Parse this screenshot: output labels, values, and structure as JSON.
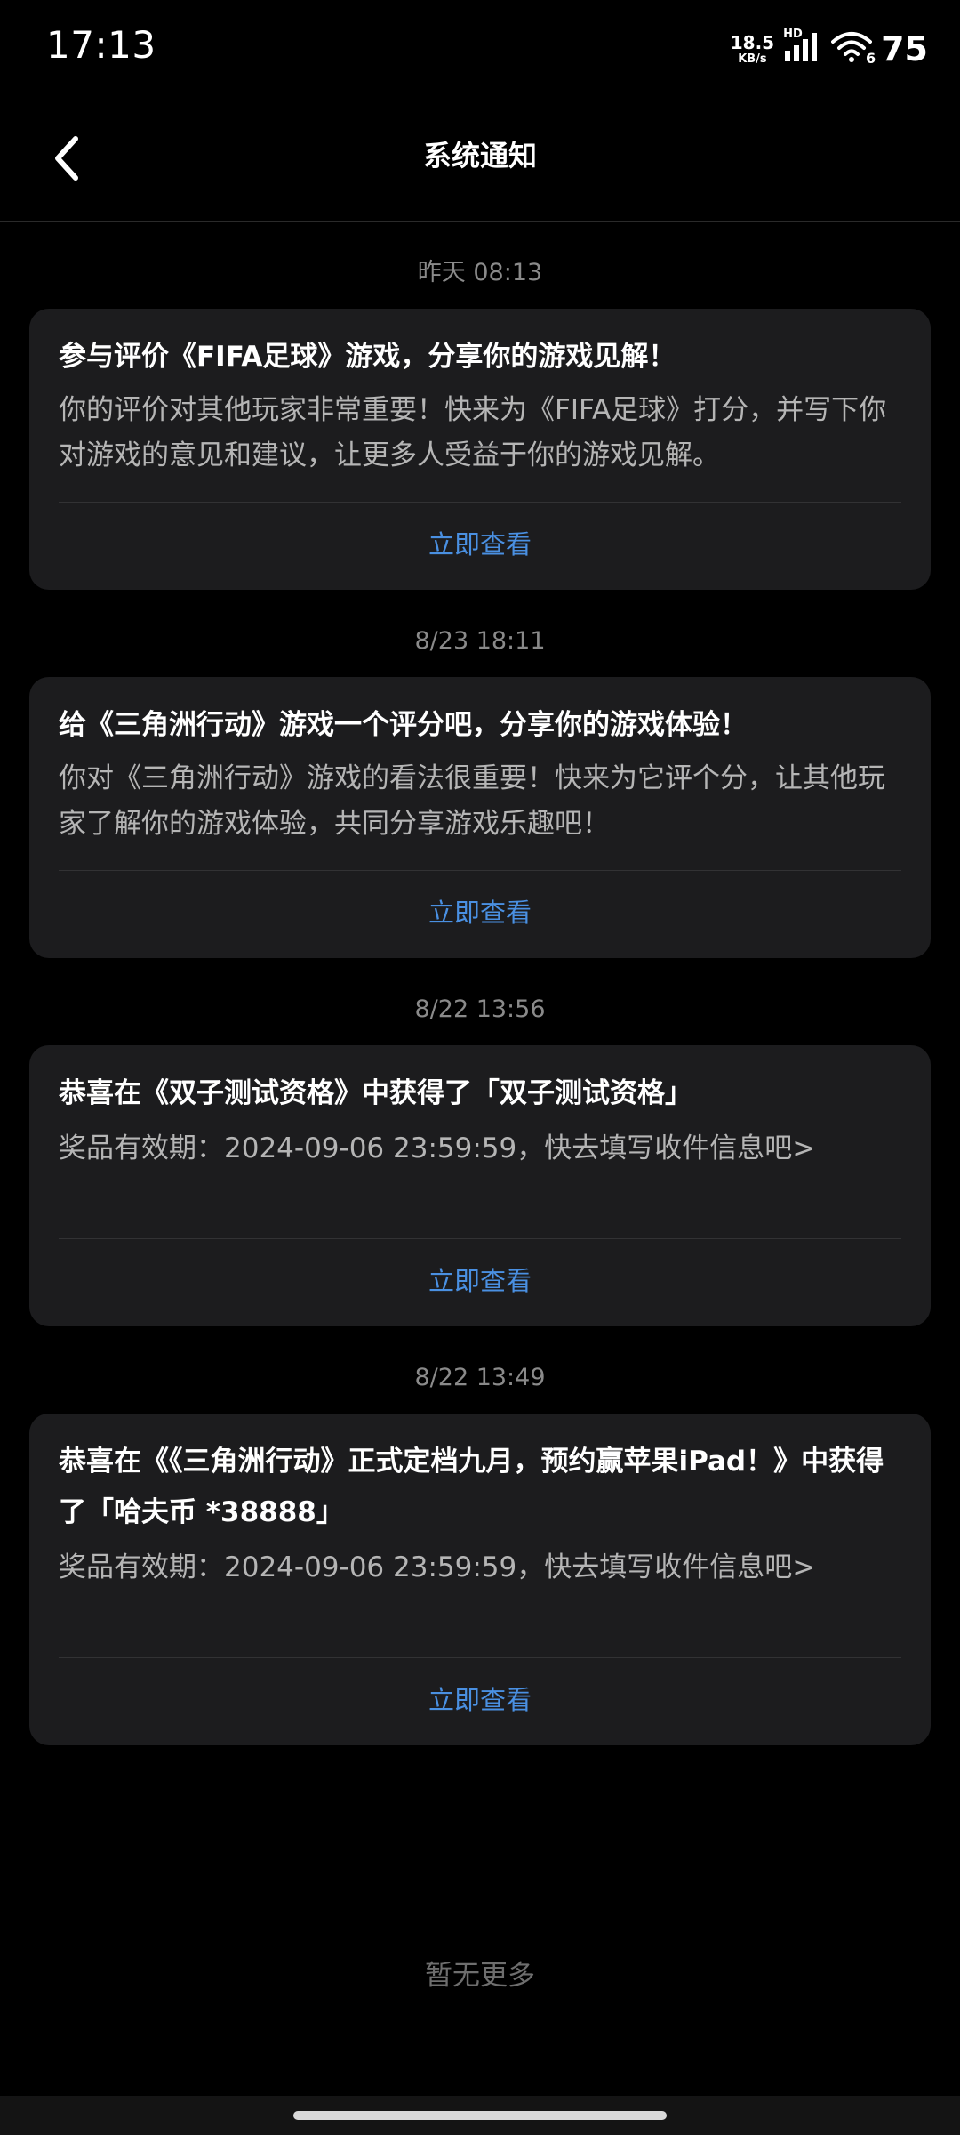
{
  "status_bar": {
    "time": "17:13",
    "net_speed_value": "18.5",
    "net_speed_unit": "KB/s",
    "hd_label": "HD",
    "wifi_badge": "6",
    "battery": "75"
  },
  "header": {
    "title": "系统通知"
  },
  "notices": [
    {
      "timestamp": "昨天  08:13",
      "title": "参与评价《FIFA足球》游戏，分享你的游戏见解！",
      "body": "你的评价对其他玩家非常重要！快来为《FIFA足球》打分，并写下你对游戏的意见和建议，让更多人受益于你的游戏见解。",
      "action": "立即查看"
    },
    {
      "timestamp": "8/23  18:11",
      "title": "给《三角洲行动》游戏一个评分吧，分享你的游戏体验！",
      "body": "你对《三角洲行动》游戏的看法很重要！快来为它评个分，让其他玩家了解你的游戏体验，共同分享游戏乐趣吧！",
      "action": "立即查看"
    },
    {
      "timestamp": "8/22  13:56",
      "title": "恭喜在《双子测试资格》中获得了「双子测试资格」",
      "body": "奖品有效期：2024-09-06 23:59:59，快去填写收件信息吧>",
      "action": "立即查看"
    },
    {
      "timestamp": "8/22  13:49",
      "title": "恭喜在《《三角洲行动》正式定档九月，预约赢苹果iPad！》中获得了「哈夫币 *38888」",
      "body": "奖品有效期：2024-09-06 23:59:59，快去填写收件信息吧>",
      "action": "立即查看"
    }
  ],
  "footer": {
    "no_more": "暂无更多"
  },
  "colors": {
    "background": "#000000",
    "card": "#1c1c1e",
    "link": "#4a90e2",
    "muted": "#8a8a8a"
  }
}
